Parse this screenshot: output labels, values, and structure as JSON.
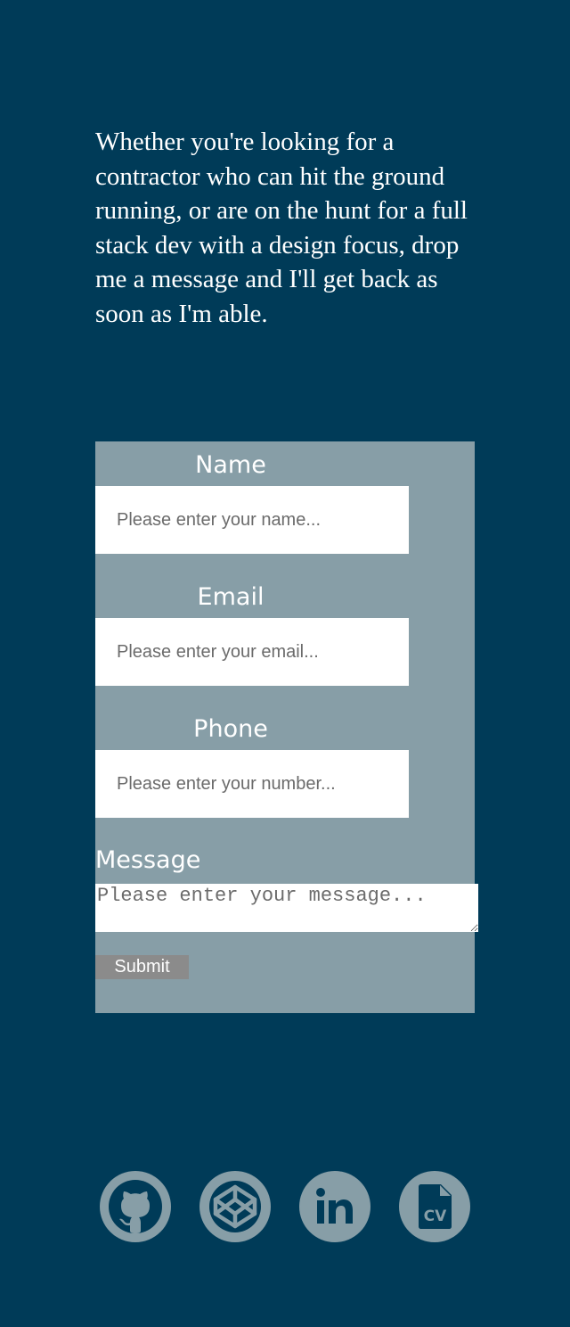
{
  "intro": {
    "text": "Whether you're looking for a contractor who can hit the ground running, or are on the hunt for a full stack dev with a design focus, drop me a message and I'll get back as soon as I'm able."
  },
  "form": {
    "name_label": "Name",
    "name_placeholder": "Please enter your name...",
    "email_label": "Email",
    "email_placeholder": "Please enter your email...",
    "phone_label": "Phone",
    "phone_placeholder": "Please enter your number...",
    "message_label": "Message",
    "message_placeholder": "Please enter your message...",
    "submit_label": "Submit"
  },
  "socials": {
    "icons": [
      "github-icon",
      "codepen-icon",
      "linkedin-icon",
      "cv-file-icon"
    ],
    "cv_text": "CV"
  },
  "colors": {
    "background": "#003b58",
    "form_panel": "#879ea7",
    "icon_fill": "#879ea7",
    "submit_button": "#8b8b8b",
    "text": "#ffffff"
  }
}
